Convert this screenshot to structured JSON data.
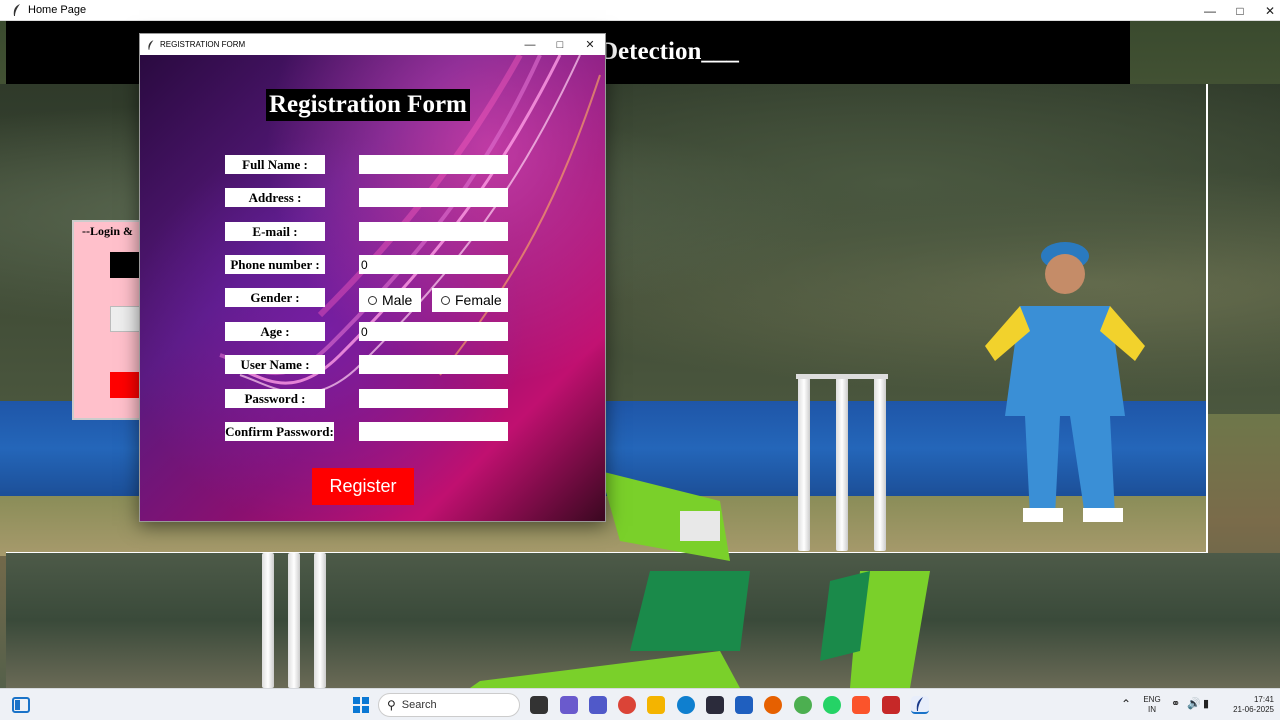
{
  "main_window": {
    "title": "Home Page",
    "header_title": "Detection___"
  },
  "login_panel": {
    "label": "--Login &"
  },
  "registration": {
    "window_title": "REGISTRATION FORM",
    "heading": "Registration Form",
    "fields": [
      {
        "label": "Full Name :",
        "value": ""
      },
      {
        "label": "Address :",
        "value": ""
      },
      {
        "label": "E-mail :",
        "value": ""
      },
      {
        "label": "Phone number :",
        "value": "0"
      },
      {
        "label": "Gender :",
        "value": ""
      },
      {
        "label": "Age :",
        "value": "0"
      },
      {
        "label": "User Name :",
        "value": ""
      },
      {
        "label": "Password :",
        "value": ""
      },
      {
        "label": "Confirm Password:",
        "value": ""
      }
    ],
    "gender_options": [
      "Male",
      "Female"
    ],
    "register_label": "Register"
  },
  "taskbar": {
    "search_placeholder": "Search",
    "language": "ENG",
    "region": "IN",
    "time": "17:41",
    "date": "21-06-2025"
  },
  "colors": {
    "register_button": "#ff0000",
    "header_bar": "#000000",
    "login_panel": "#ffc0cb"
  }
}
